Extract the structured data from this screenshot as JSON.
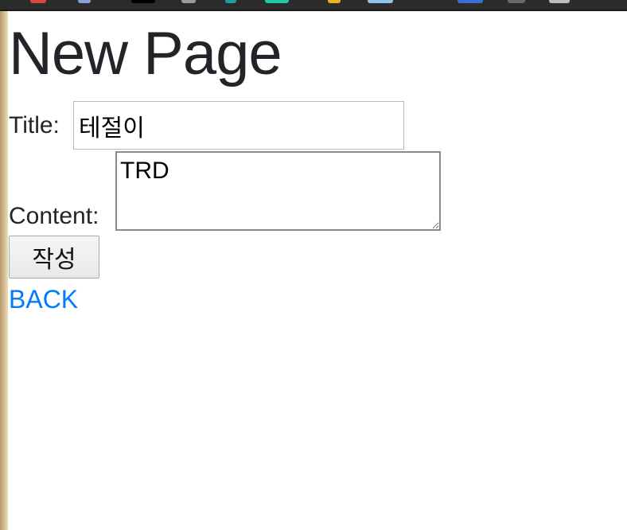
{
  "page": {
    "heading": "New Page",
    "title_label": "Title:",
    "title_value": "테절이",
    "content_label": "Content:",
    "content_value": "TRD",
    "submit_label": "작성",
    "back_label": "BACK"
  },
  "colors": {
    "link": "#007bff",
    "text": "#212529"
  }
}
